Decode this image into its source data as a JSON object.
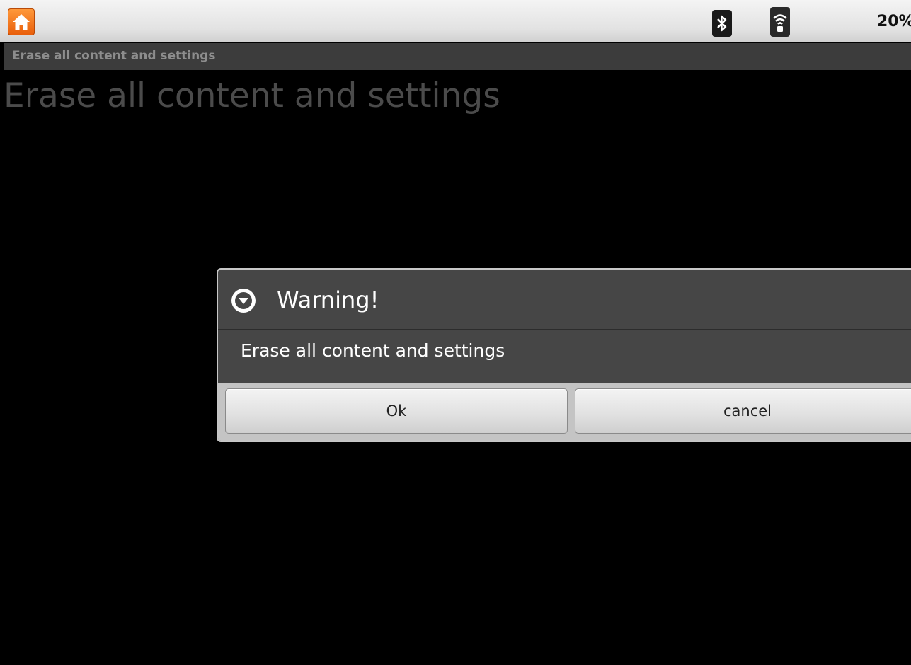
{
  "status_bar": {
    "home_icon": "home-icon",
    "bluetooth_icon": "bluetooth-icon",
    "wifi_icon": "wifi-icon",
    "battery_text": "20%",
    "colors": {
      "home_accent": "#f07a1e"
    }
  },
  "title_bar": {
    "title": "Erase all content and settings"
  },
  "page": {
    "heading": "Erase all content and settings"
  },
  "dialog": {
    "icon": "warning-icon",
    "title": "Warning!",
    "message": "Erase all content and settings",
    "buttons": {
      "ok": "Ok",
      "cancel": "cancel"
    }
  }
}
